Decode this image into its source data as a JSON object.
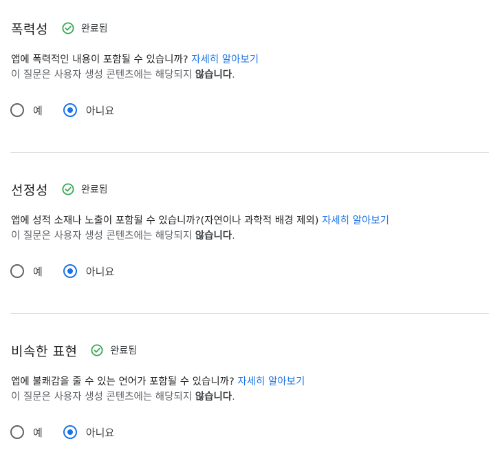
{
  "colors": {
    "accent": "#1a73e8",
    "success": "#34a853",
    "text": "#202124",
    "muted": "#5f6368",
    "divider": "#dadce0"
  },
  "sections": [
    {
      "title": "폭력성",
      "status_icon": "check-circle-icon",
      "status": "완료됨",
      "question": "앱에 폭력적인 내용이 포함될 수 있습니까?",
      "learn_more": "자세히 알아보기",
      "note_prefix": "이 질문은 사용자 생성 콘텐츠에는 해당되지 ",
      "note_bold": "않습니다",
      "note_suffix": ".",
      "option_yes": "예",
      "option_no": "아니요",
      "selected": "아니요"
    },
    {
      "title": "선정성",
      "status_icon": "check-circle-icon",
      "status": "완료됨",
      "question": "앱에 성적 소재나 노출이 포함될 수 있습니까?(자연이나 과학적 배경 제외)",
      "learn_more": "자세히 알아보기",
      "note_prefix": "이 질문은 사용자 생성 콘텐츠에는 해당되지 ",
      "note_bold": "않습니다",
      "note_suffix": ".",
      "option_yes": "예",
      "option_no": "아니요",
      "selected": "아니요"
    },
    {
      "title": "비속한 표현",
      "status_icon": "check-circle-icon",
      "status": "완료됨",
      "question": "앱에 불쾌감을 줄 수 있는 언어가 포함될 수 있습니까?",
      "learn_more": "자세히 알아보기",
      "note_prefix": "이 질문은 사용자 생성 콘텐츠에는 해당되지 ",
      "note_bold": "않습니다",
      "note_suffix": ".",
      "option_yes": "예",
      "option_no": "아니요",
      "selected": "아니요"
    }
  ]
}
